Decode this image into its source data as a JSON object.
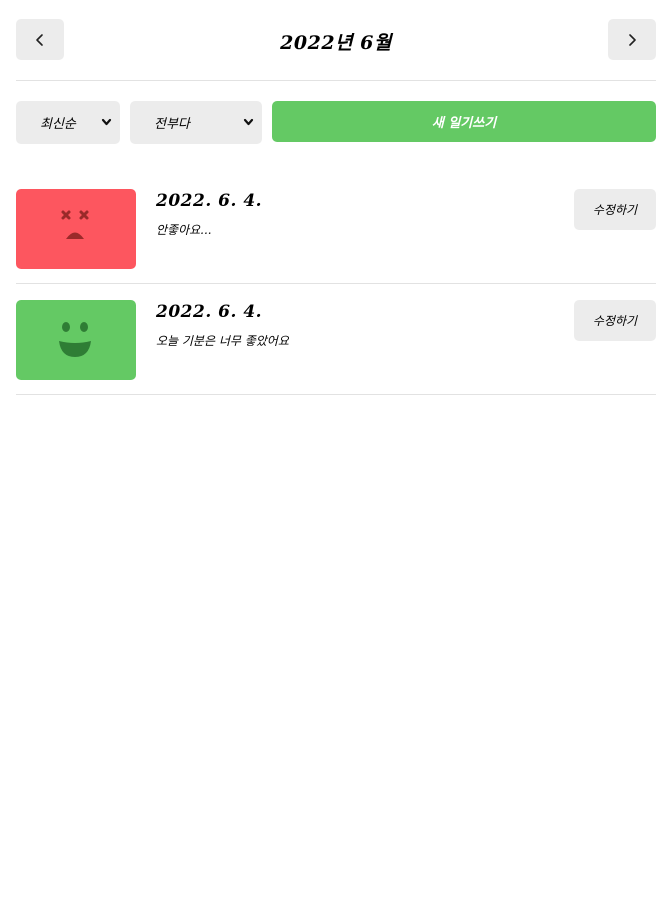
{
  "header": {
    "title": "2022년 6월",
    "prev_icon": "chevron-left-icon",
    "next_icon": "chevron-right-icon"
  },
  "controls": {
    "order_select": {
      "value": "최신순",
      "icon": "chevron-down-icon"
    },
    "filter_select": {
      "value": "전부다",
      "icon": "chevron-down-icon"
    },
    "new_button_label": "새 일기쓰기",
    "new_button_color": "#64c964"
  },
  "diary_list": [
    {
      "date": "2022. 6. 4.",
      "content": "안좋아요...",
      "emotion_icon": "terrible-face-icon",
      "emotion_color": "#fd565f",
      "edit_label": "수정하기"
    },
    {
      "date": "2022. 6. 4.",
      "content": "오늘 기분은 너무 좋았어요",
      "emotion_icon": "great-face-icon",
      "emotion_color": "#64c964",
      "edit_label": "수정하기"
    }
  ]
}
